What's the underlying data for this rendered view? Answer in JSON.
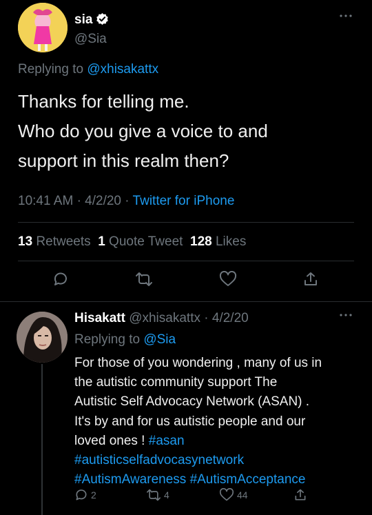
{
  "main_tweet": {
    "display_name": "sia",
    "handle": "@Sia",
    "more_icon": "more-icon",
    "replying_prefix": "Replying to",
    "replying_to": "@xhisakattx",
    "body_lines": [
      "Thanks for telling me.",
      "Who do you give a voice to and",
      "support in this realm then?"
    ],
    "time": "10:41 AM",
    "sep1": "·",
    "date": "4/2/20",
    "sep2": "·",
    "source": "Twitter for iPhone",
    "retweets_count": "13",
    "retweets_label": "Retweets",
    "quotes_count": "1",
    "quotes_label": "Quote Tweet",
    "likes_count": "128",
    "likes_label": "Likes",
    "action_icons": [
      "reply-icon",
      "retweet-icon",
      "like-icon",
      "share-icon"
    ]
  },
  "reply_tweet": {
    "display_name": "Hisakatt",
    "handle": "@xhisakattx",
    "sep": "·",
    "date": "4/2/20",
    "replying_prefix": "Replying to",
    "replying_to": "@Sia",
    "body_lines": [
      "For those of you wondering , many of us in",
      "the autistic community support The",
      "Autistic Self Advocacy Network (ASAN) .",
      "It's by and for us autistic people and our"
    ],
    "body_line5_text": "loved ones ! ",
    "hashtag_asan": "#asan",
    "hashtag_network": "#autisticselfadvocasynetwork",
    "hashtag_awareness": "#AutismAwareness",
    "hashtag_acceptance": "#AutismAcceptance",
    "reply_count": "2",
    "retweet_count": "4",
    "like_count": "44"
  },
  "colors": {
    "background": "#000000",
    "text": "#e7e9ea",
    "muted": "#6e767d",
    "link": "#1d9bf0",
    "avatar_bg": "#f2cf55"
  }
}
